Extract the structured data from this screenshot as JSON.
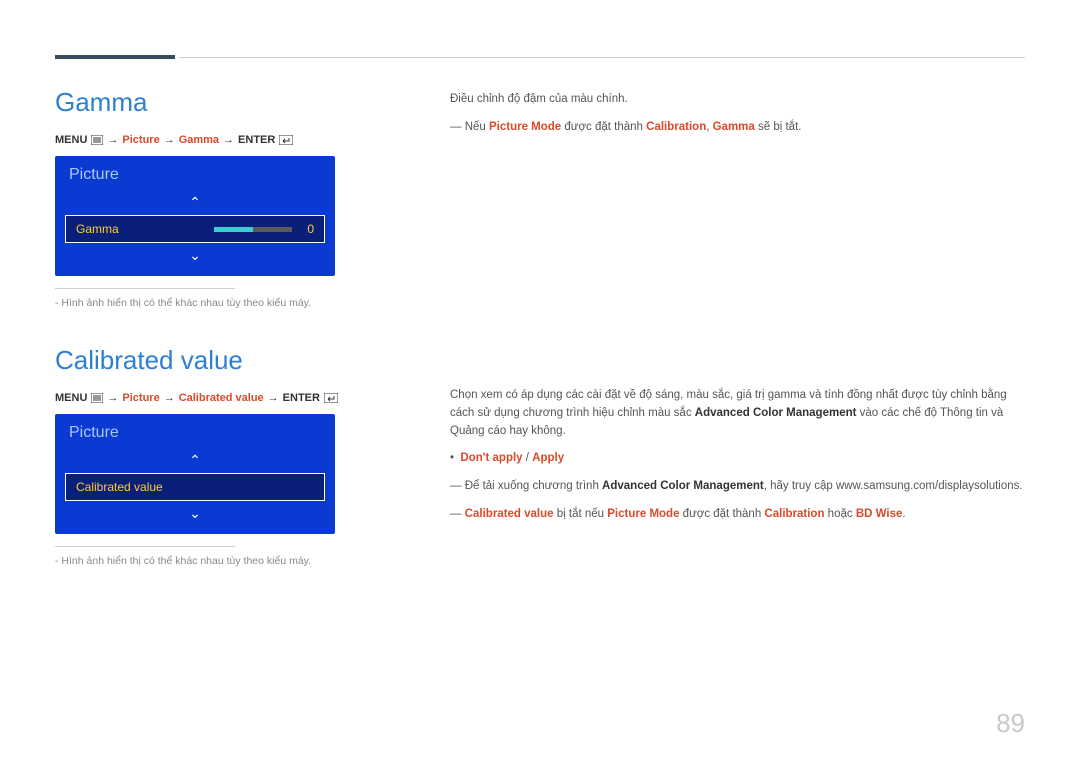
{
  "header": {},
  "sections": {
    "gamma": {
      "title": "Gamma",
      "breadcrumb": {
        "menu": "MENU",
        "path1": "Picture",
        "path2": "Gamma",
        "enter": "ENTER"
      },
      "osd": {
        "panel_title": "Picture",
        "row_label": "Gamma",
        "value": "0"
      },
      "note": "- Hình ảnh hiển thị có thể khác nhau tùy theo kiểu máy.",
      "body": {
        "line1": "Điều chỉnh độ đậm của màu chính.",
        "line2_pre": "― Nếu ",
        "line2_pm": "Picture Mode",
        "line2_mid": " được đặt thành ",
        "line2_cal": "Calibration",
        "line2_sep": ", ",
        "line2_gamma": "Gamma",
        "line2_post": " sẽ bị tắt."
      }
    },
    "calibrated": {
      "title": "Calibrated value",
      "breadcrumb": {
        "menu": "MENU",
        "path1": "Picture",
        "path2": "Calibrated value",
        "enter": "ENTER"
      },
      "osd": {
        "panel_title": "Picture",
        "row_label": "Calibrated value"
      },
      "note": "- Hình ảnh hiển thị có thể khác nhau tùy theo kiểu máy.",
      "body": {
        "para1_a": "Chọn xem có áp dụng các cài đặt về độ sáng, màu sắc, giá trị gamma và tính đồng nhất được tùy chỉnh bằng cách sử dụng chương trình hiệu chỉnh màu sắc ",
        "para1_b": "Advanced Color Management",
        "para1_c": " vào các chế độ Thông tin và Quảng cáo hay không.",
        "options_dont": "Don't apply",
        "options_sep": " / ",
        "options_apply": "Apply",
        "dl_a": "― Để tải xuống chương trình ",
        "dl_b": "Advanced Color Management",
        "dl_c": ", hãy truy cập www.samsung.com/displaysolutions.",
        "warn_a": "Calibrated value",
        "warn_b": " bị tắt nếu ",
        "warn_c": "Picture Mode",
        "warn_d": " được đặt thành ",
        "warn_e": "Calibration",
        "warn_f": " hoặc ",
        "warn_g": "BD Wise",
        "warn_h": "."
      }
    }
  },
  "page_number": "89"
}
